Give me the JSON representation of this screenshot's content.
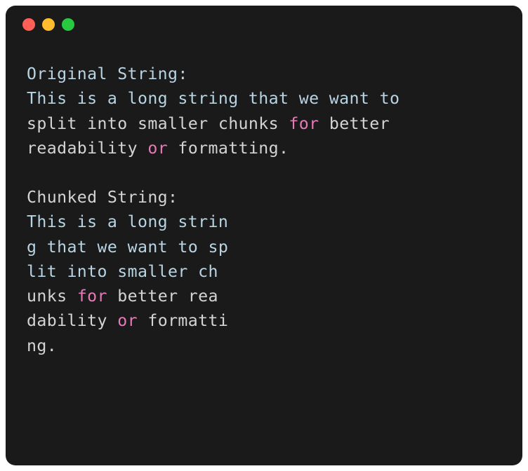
{
  "titlebar": {
    "buttons": [
      "close",
      "minimize",
      "maximize"
    ]
  },
  "content": {
    "heading1": "Original String:",
    "line1_a": "This is a long string that we want to ",
    "line2_a": "split into smaller chunks ",
    "line2_kw": "for",
    "line2_b": " better ",
    "line3_a": "readability ",
    "line3_kw": "or",
    "line3_b": " formatting.",
    "heading2": "Chunked String:",
    "chunk1": "This is a long strin",
    "chunk2": "g that we want to sp",
    "chunk3": "lit into smaller ch",
    "chunk4_a": "unks ",
    "chunk4_kw": "for",
    "chunk4_b": " better rea",
    "chunk5_a": "dability ",
    "chunk5_kw": "or",
    "chunk5_b": " formatti",
    "chunk6": "ng."
  }
}
